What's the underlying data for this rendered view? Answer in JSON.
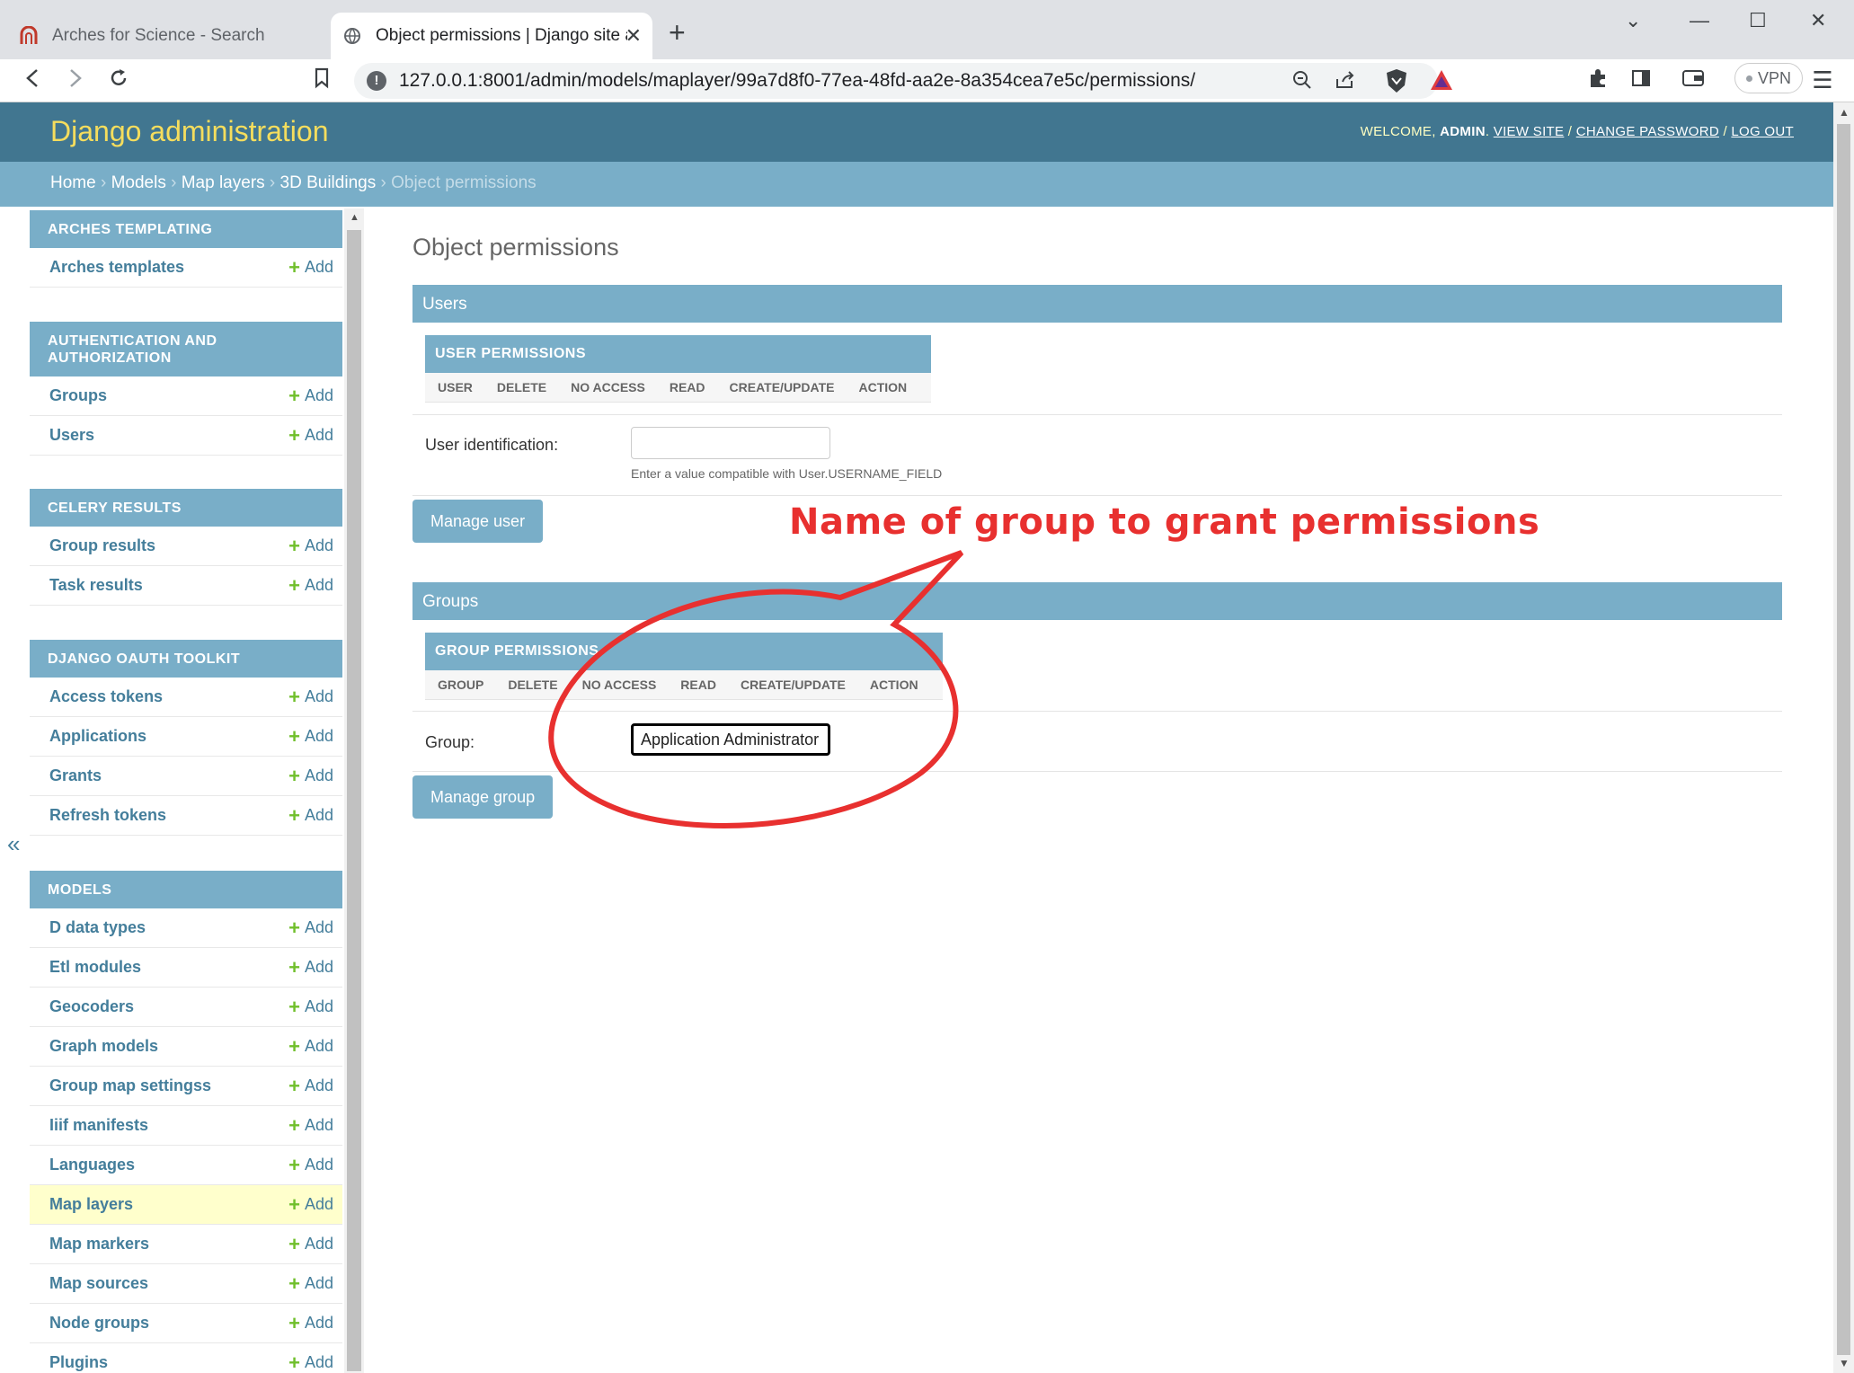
{
  "browser": {
    "tabs": [
      {
        "title": "Arches for Science - Search",
        "active": false
      },
      {
        "title": "Object permissions | Django site a",
        "active": true
      }
    ],
    "url": "127.0.0.1:8001/admin/models/maplayer/99a7d8f0-77ea-48fd-aa2e-8a354cea7e5c/permissions/",
    "vpn_label": "VPN"
  },
  "header": {
    "brand": "Django administration",
    "welcome": "WELCOME, ",
    "user": "ADMIN",
    "view_site": "VIEW SITE",
    "change_password": "CHANGE PASSWORD",
    "log_out": "LOG OUT",
    "sep": " / "
  },
  "breadcrumbs": {
    "home": "Home",
    "models": "Models",
    "map_layers": "Map layers",
    "item": "3D Buildings",
    "current": "Object permissions",
    "sep": " › "
  },
  "sidebar": {
    "add_label": "Add",
    "modules": [
      {
        "caption": "ARCHES TEMPLATING",
        "items": [
          "Arches templates"
        ]
      },
      {
        "caption": "AUTHENTICATION AND AUTHORIZATION",
        "items": [
          "Groups",
          "Users"
        ]
      },
      {
        "caption": "CELERY RESULTS",
        "items": [
          "Group results",
          "Task results"
        ]
      },
      {
        "caption": "DJANGO OAUTH TOOLKIT",
        "items": [
          "Access tokens",
          "Applications",
          "Grants",
          "Refresh tokens"
        ]
      },
      {
        "caption": "MODELS",
        "items": [
          "D data types",
          "Etl modules",
          "Geocoders",
          "Graph models",
          "Group map settingss",
          "Iiif manifests",
          "Languages",
          "Map layers",
          "Map markers",
          "Map sources",
          "Node groups",
          "Plugins"
        ]
      }
    ],
    "selected": "Map layers"
  },
  "content": {
    "title": "Object permissions",
    "users": {
      "bar": "Users",
      "table_caption": "USER PERMISSIONS",
      "columns": [
        "USER",
        "DELETE",
        "NO ACCESS",
        "READ",
        "CREATE/UPDATE",
        "ACTION"
      ],
      "field_label": "User identification:",
      "field_value": "",
      "help": "Enter a value compatible with User.USERNAME_FIELD",
      "button": "Manage user"
    },
    "groups": {
      "bar": "Groups",
      "table_caption": "GROUP PERMISSIONS",
      "columns": [
        "GROUP",
        "DELETE",
        "NO ACCESS",
        "READ",
        "CREATE/UPDATE",
        "ACTION"
      ],
      "field_label": "Group:",
      "field_value": "Application Administrator",
      "button": "Manage group"
    }
  },
  "annotation": {
    "text": "Name of group to grant permissions",
    "color": "#e8302f"
  },
  "colors": {
    "header_bg": "#417690",
    "brand": "#f5dd5d",
    "module_bg": "#79aec8",
    "link": "#447e9b",
    "add_plus": "#70bf2b",
    "selected_row": "#ffffcc"
  }
}
